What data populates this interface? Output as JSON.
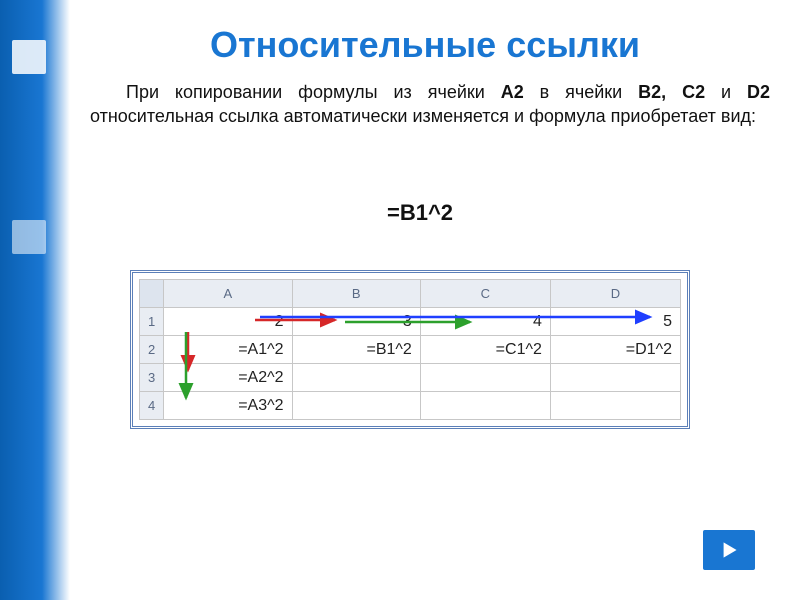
{
  "title": "Относительные ссылки",
  "paragraph_parts": {
    "p1": "При копировании формулы из ячейки ",
    "bold1": "А2",
    "p2": " в ячейки ",
    "bold2": "B2, С2",
    "p3": " и ",
    "bold3": "D2",
    "p4": " относительная ссылка автоматически изменяется и формула приобретает вид:"
  },
  "formula_overlay": "=B1^2",
  "sheet": {
    "cols": [
      "A",
      "B",
      "C",
      "D"
    ],
    "rows": [
      "1",
      "2",
      "3",
      "4"
    ],
    "row1": [
      "2",
      "3",
      "4",
      "5"
    ],
    "row2": [
      "=A1^2",
      "=B1^2",
      "=C1^2",
      "=D1^2"
    ],
    "row3": [
      "=A2^2",
      "",
      "",
      ""
    ],
    "row4": [
      "=A3^2",
      "",
      "",
      ""
    ]
  },
  "colors": {
    "accent": "#1976d2",
    "arrow_red": "#d62728",
    "arrow_green": "#2ca02c",
    "arrow_blue": "#1f3fff"
  }
}
